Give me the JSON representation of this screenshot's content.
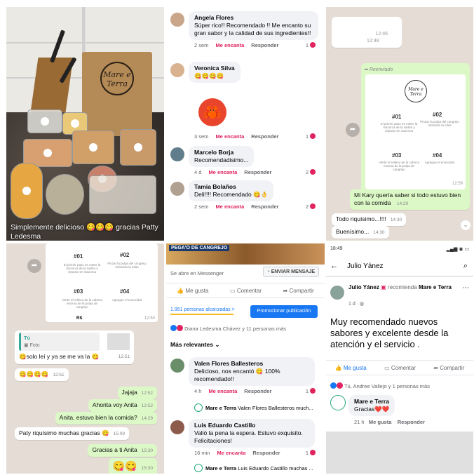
{
  "photo": {
    "logo_text": "Mare e Terra",
    "caption": "Simplemente delicioso 😋😋😋 gracias Patty Ledesma"
  },
  "comments1": [
    {
      "author": "Angela Flores",
      "text": "Súper rico!! Recomendado !! Me encanto su gran sabor y la calidad de sus ingredientes!!",
      "time": "2 sem",
      "count": "1"
    },
    {
      "author": "Veronica Silva",
      "text": "😋😋😋😋",
      "time": "",
      "count": ""
    },
    {
      "author": "",
      "text": "🦀",
      "time": "3 sem",
      "count": "1"
    },
    {
      "author": "Marcelo Borja",
      "text": "Recomendadisimo...",
      "time": "4 d",
      "count": "2"
    },
    {
      "author": "Tamia Bolaños",
      "text": "Deli!!!! Recomendado 😋👌",
      "time": "2 sem",
      "count": "2"
    }
  ],
  "comment_labels": {
    "like": "Me encanta",
    "reply": "Responder"
  },
  "chat1": {
    "forward_label": "Reenviado",
    "card": {
      "logo": "Mare e Terra",
      "items": [
        {
          "num": "#01",
          "text": "El primer paso es meter la mazorca de la sartén y separar en mazorca"
        },
        {
          "num": "#02",
          "text": "Pinzar la pulpa del congrejo retirando la tolas"
        },
        {
          "num": "#03",
          "text": "Vierte el relleno de la cabeza encima de la pulpa de cangrejo"
        },
        {
          "num": "#04",
          "text": "Agregue el ensucidat"
        }
      ],
      "time": "12:59"
    },
    "top_times": [
      "12:46",
      "12:48"
    ],
    "messages": [
      {
        "text": "Mi Kary quería saber si todo estuvo bien con la comida",
        "time": "14:29"
      },
      {
        "text": "Todo riquísimo...!!!!",
        "time": "14:30"
      },
      {
        "text": "Buenísimo...",
        "time": "14:30"
      }
    ]
  },
  "chat2": {
    "card_items": [
      {
        "num": "#01",
        "text": "El primer paso es meter la mazorca de la sartén y separar en mazorca"
      },
      {
        "num": "#02",
        "text": "Pinzar la pulpa del congrejo retirando la tolas"
      },
      {
        "num": "#03",
        "text": "Vierte el relleno de la cabeza encima de la pulpa de cangrejo"
      },
      {
        "num": "#04",
        "text": "Agregue el ensucidat"
      }
    ],
    "card_time": "12:50",
    "card_tail": "RS",
    "quote_author": "Tú",
    "quote_label": "Foto",
    "messages": [
      {
        "text": "😋solo leí y ya se me va la 😋",
        "time": "12:51",
        "dir": "in"
      },
      {
        "text": "😋😋😋😋",
        "time": "12:51",
        "dir": "in"
      },
      {
        "text": "Jajaja",
        "time": "12:52",
        "dir": "out"
      },
      {
        "text": "Ahorita voy Anita",
        "time": "12:52",
        "dir": "out"
      },
      {
        "text": "Anita, estuvo bien la comida?",
        "time": "14:29",
        "dir": "out"
      },
      {
        "text": "Paty riquísimo muchas gracias 😋",
        "time": "15:09",
        "dir": "in"
      },
      {
        "text": "Gracias a ti Anita",
        "time": "15:30",
        "dir": "out"
      },
      {
        "text": "😋😋",
        "time": "15:30",
        "dir": "out"
      }
    ]
  },
  "post1": {
    "banner": "PEGA'O DE CANGREJO",
    "messenger_note": "Se abre en Messenger",
    "send_btn": "ENVIAR MENSAJE",
    "actions": [
      "Me gusta",
      "Comentar",
      "Compartir"
    ],
    "reach": "1.951 personas alcanzadas >",
    "promote": "Promocionar publicación",
    "reactions": "Diana Ledesma Chávez y 11 personas más",
    "sort": "Más relevantes",
    "comments": [
      {
        "author": "Valen Flores Ballesteros",
        "text": "Delicioso, nos encantó 😋 100% recomendado!!",
        "time": "4 h",
        "count": "1",
        "reply_name": "Mare e Terra",
        "reply_text": "Valen Flores Ballesteros much..."
      },
      {
        "author": "Luis Eduardo Castillo",
        "text": "Valió la pena la espera. Estuvo exquisito. Felicitaciones!",
        "time": "16 min",
        "count": "1",
        "reply_name": "Mare e Terra",
        "reply_text": "Luis Eduardo Castillo muchas ..."
      }
    ]
  },
  "post2": {
    "status_time": "18:49",
    "title": "Julio Yánez",
    "author": "Julio Yánez",
    "recommends": "recomienda",
    "page": "Mare e Terra",
    "age": "1 d",
    "body": "Muy recomendado nuevos sabores y excelente desde la atención y el servicio .",
    "actions": [
      "Me gusta",
      "Comentar",
      "Compartir"
    ],
    "reactions": "Tú, Andree Vallejo y 1 personas más",
    "reply": {
      "author": "Mare e Terra",
      "text": "Gracias❤️❤️",
      "time": "21 h",
      "like": "Me gusta",
      "respond": "Responder"
    }
  },
  "colors": {
    "fb_blue": "#1877f2",
    "love_red": "#e0245e",
    "wa_green": "#dcf8c6",
    "wa_bg": "#e5ddd5"
  }
}
